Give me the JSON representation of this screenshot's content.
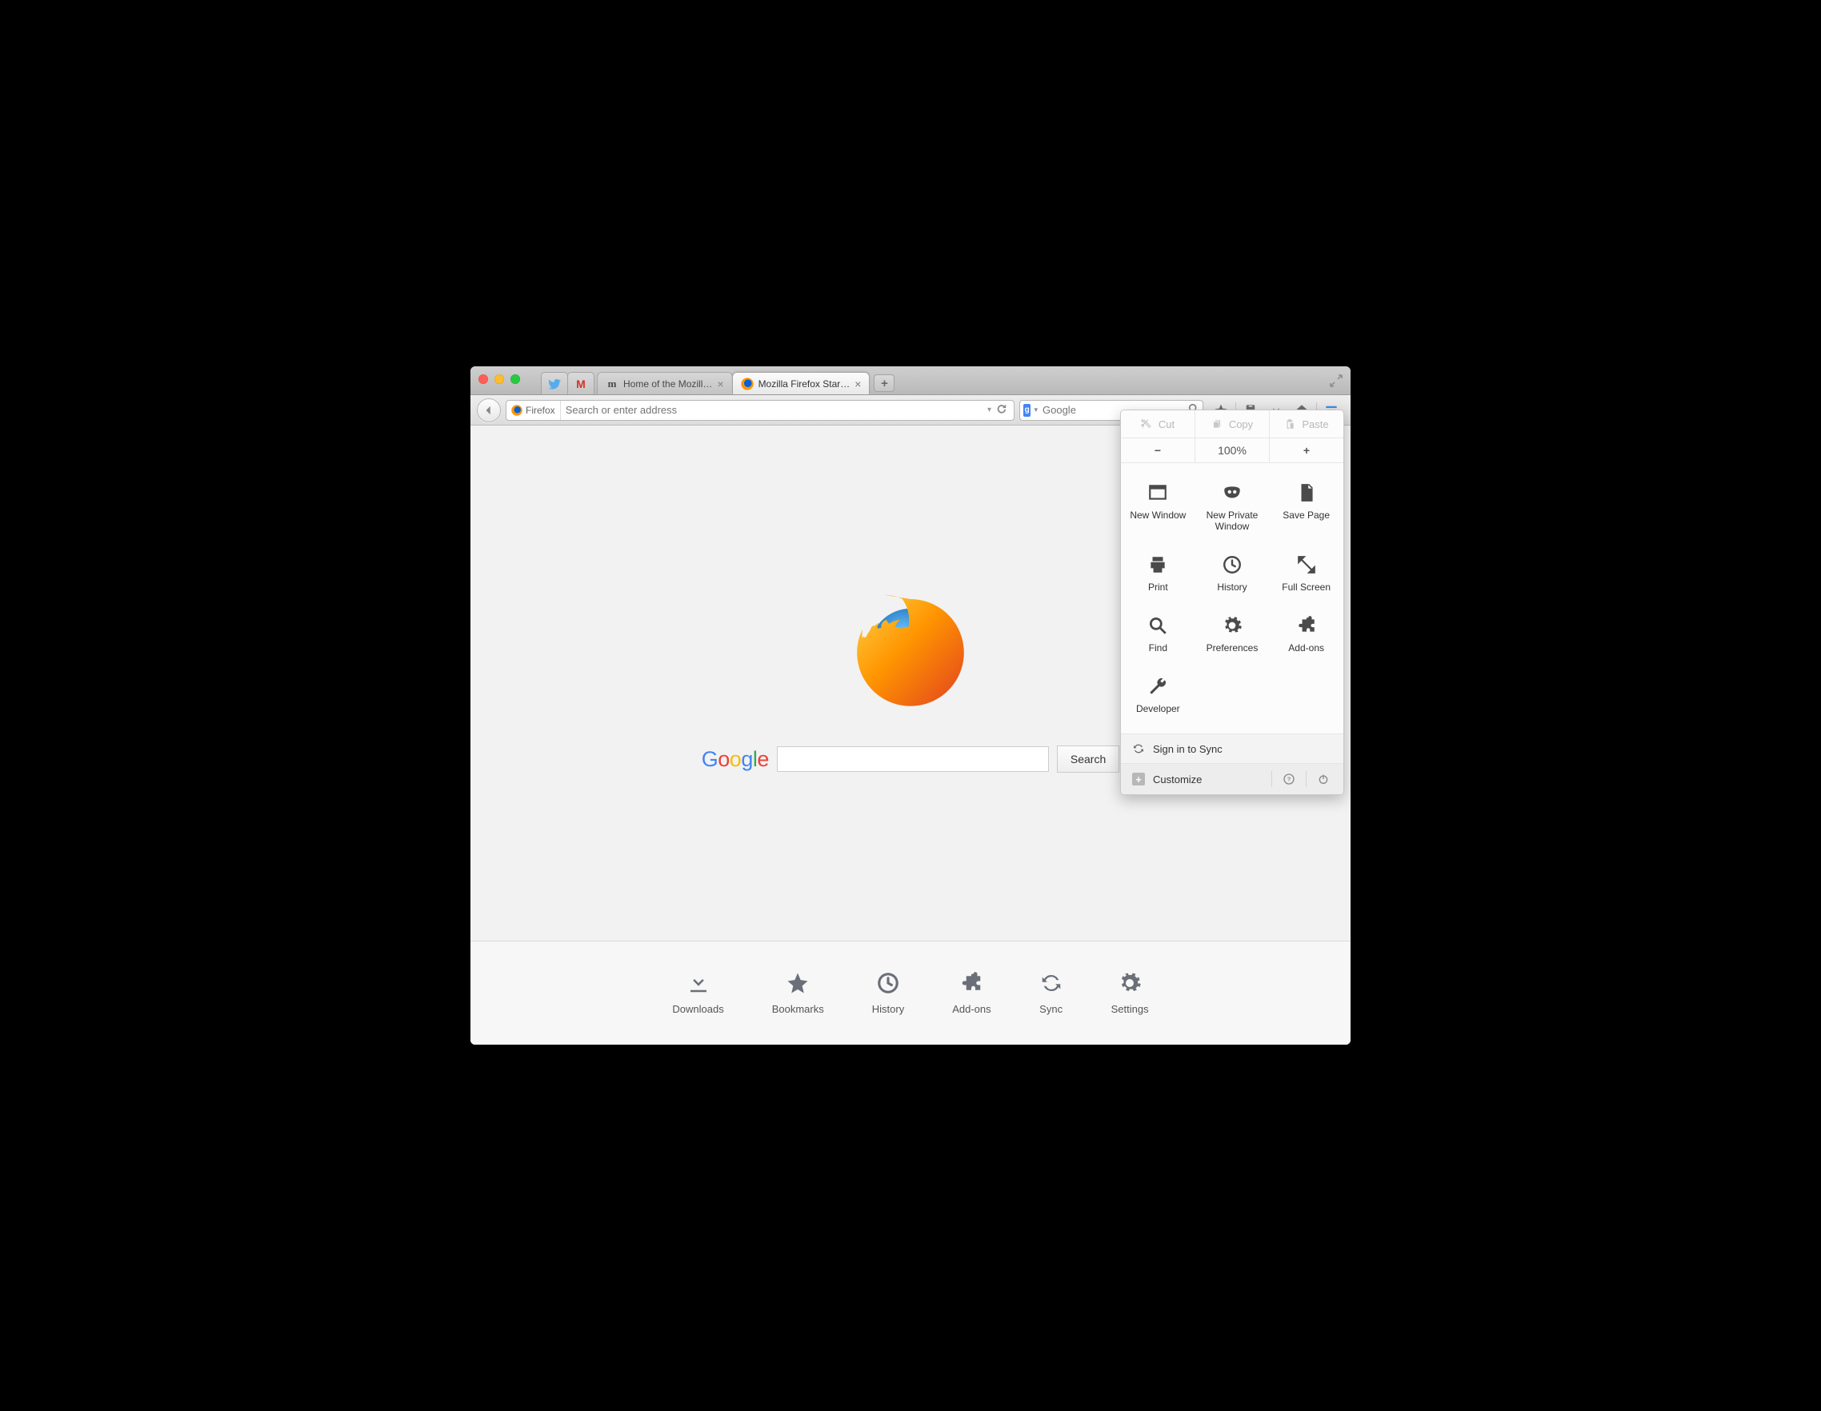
{
  "tabs": {
    "bg0_title": "Home of the Mozill…",
    "active_title": "Mozilla Firefox Star…"
  },
  "urlbar": {
    "identity_label": "Firefox",
    "placeholder": "Search or enter address"
  },
  "searchbar": {
    "engine_letter": "g",
    "placeholder": "Google"
  },
  "content": {
    "google_logo_text": "Google",
    "search_button": "Search"
  },
  "launcher": {
    "downloads": "Downloads",
    "bookmarks": "Bookmarks",
    "history": "History",
    "addons": "Add-ons",
    "sync": "Sync",
    "settings": "Settings"
  },
  "menu": {
    "cut": "Cut",
    "copy": "Copy",
    "paste": "Paste",
    "zoom_level": "100%",
    "new_window": "New Window",
    "new_private": "New Private Window",
    "save_page": "Save Page",
    "print": "Print",
    "history": "History",
    "fullscreen": "Full Screen",
    "find": "Find",
    "preferences": "Preferences",
    "addons": "Add-ons",
    "developer": "Developer",
    "sync": "Sign in to Sync",
    "customize": "Customize"
  }
}
